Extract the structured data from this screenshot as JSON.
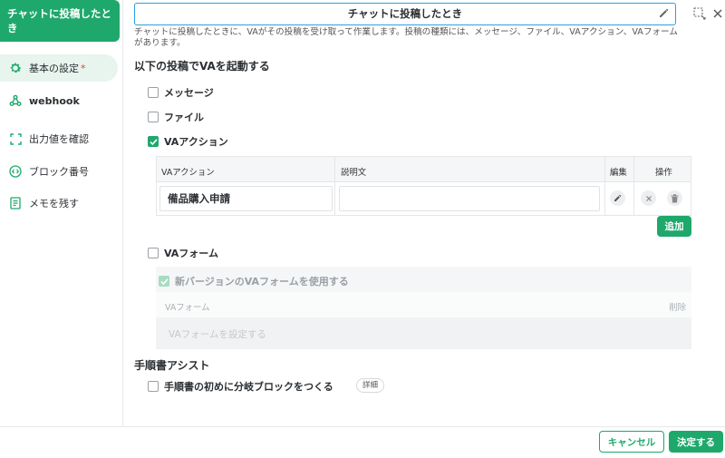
{
  "sidebar": {
    "title": "チャットに投稿したとき",
    "items": [
      {
        "label": "基本の設定",
        "required_mark": "*",
        "icon": "gear-icon"
      },
      {
        "label": "webhook",
        "icon": "webhook-icon"
      },
      {
        "label": "出力値を確認",
        "icon": "frame-icon"
      },
      {
        "label": "ブロック番号",
        "icon": "code-icon"
      },
      {
        "label": "メモを残す",
        "icon": "memo-icon"
      }
    ]
  },
  "header": {
    "title_value": "チャットに投稿したとき",
    "description": "チャットに投稿したときに、VAがその投稿を受け取って作業します。投稿の種類には、メッセージ、ファイル、VAアクション、VAフォームがあります。"
  },
  "trigger_section": {
    "heading": "以下の投稿でVAを起動する",
    "options": [
      {
        "label": "メッセージ",
        "checked": false
      },
      {
        "label": "ファイル",
        "checked": false
      },
      {
        "label": "VAアクション",
        "checked": true
      }
    ]
  },
  "va_action_table": {
    "headers": {
      "action": "VAアクション",
      "description": "説明文",
      "edit": "編集",
      "ops": "操作"
    },
    "rows": [
      {
        "action": "備品購入申請",
        "description": ""
      }
    ],
    "add_label": "追加"
  },
  "va_form": {
    "label": "VAフォーム",
    "checked": false,
    "new_version_label": "新バージョンのVAフォームを使用する",
    "column_header": "VAフォーム",
    "delete_label": "削除",
    "placeholder": "VAフォームを設定する"
  },
  "manual_assist": {
    "heading": "手順書アシスト",
    "option_label": "手順書の初めに分岐ブロックをつくる",
    "detail_label": "詳細"
  },
  "footer": {
    "cancel_label": "キャンセル",
    "confirm_label": "決定する"
  },
  "colors": {
    "accent": "#1fa86c",
    "focus": "#2d9ee0"
  }
}
